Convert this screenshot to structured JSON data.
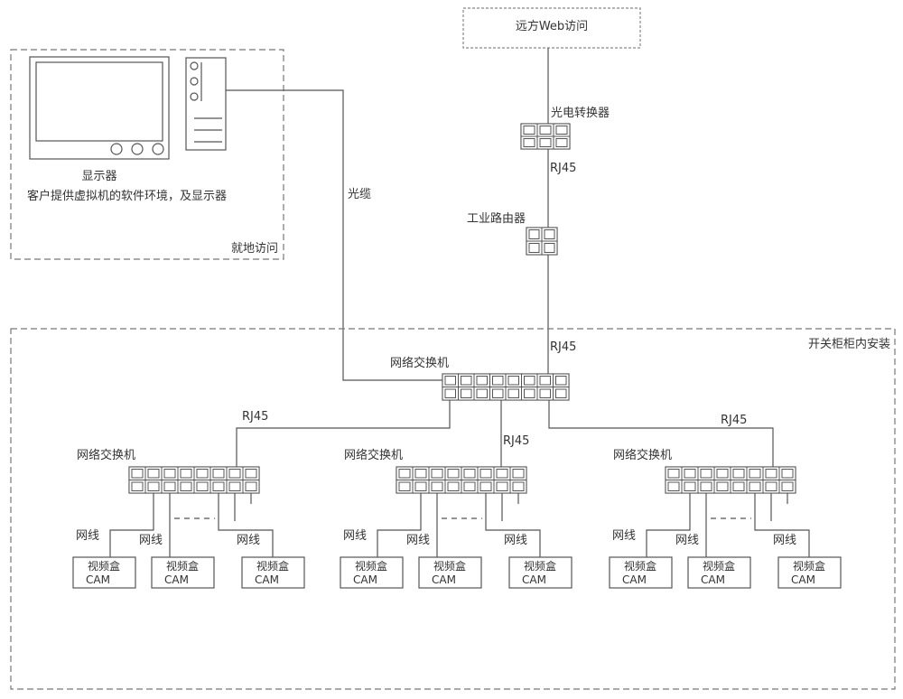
{
  "remote": {
    "label": "远方Web访问"
  },
  "optical_converter": {
    "label": "光电转换器"
  },
  "router": {
    "label": "工业路由器"
  },
  "local_access": {
    "region_label": "就地访问",
    "monitor_label": "显示器",
    "description": "客户提供虚拟机的软件环境，及显示器"
  },
  "fiber_label": "光缆",
  "cabinet": {
    "region_label": "开关柜柜内安装"
  },
  "core_switch": {
    "label": "网络交换机"
  },
  "link_labels": {
    "converter_to_router": "RJ45",
    "router_to_switch": "RJ45",
    "core_to_left": "RJ45",
    "core_to_middle": "RJ45",
    "core_to_right": "RJ45"
  },
  "access_switches": [
    {
      "label": "网络交换机",
      "cable_labels": [
        "网线",
        "网线",
        "网线"
      ],
      "cameras": [
        {
          "line1": "视频盒",
          "line2": "CAM"
        },
        {
          "line1": "视频盒",
          "line2": "CAM"
        },
        {
          "line1": "视频盒",
          "line2": "CAM"
        }
      ]
    },
    {
      "label": "网络交换机",
      "cable_labels": [
        "网线",
        "网线",
        "网线"
      ],
      "cameras": [
        {
          "line1": "视频盒",
          "line2": "CAM"
        },
        {
          "line1": "视频盒",
          "line2": "CAM"
        },
        {
          "line1": "视频盒",
          "line2": "CAM"
        }
      ]
    },
    {
      "label": "网络交换机",
      "cable_labels": [
        "网线",
        "网线",
        "网线"
      ],
      "cameras": [
        {
          "line1": "视频盒",
          "line2": "CAM"
        },
        {
          "line1": "视频盒",
          "line2": "CAM"
        },
        {
          "line1": "视频盒",
          "line2": "CAM"
        }
      ]
    }
  ]
}
